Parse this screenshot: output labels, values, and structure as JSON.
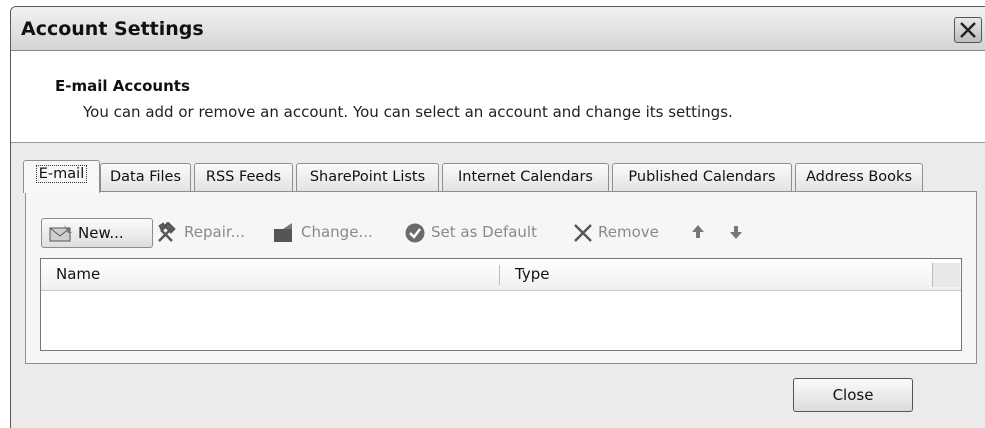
{
  "window": {
    "title": "Account Settings"
  },
  "header": {
    "title": "E-mail Accounts",
    "description": "You can add or remove an account. You can select an account and change its settings."
  },
  "tabs": [
    {
      "label": "E-mail",
      "active": true
    },
    {
      "label": "Data Files",
      "active": false
    },
    {
      "label": "RSS Feeds",
      "active": false
    },
    {
      "label": "SharePoint Lists",
      "active": false
    },
    {
      "label": "Internet Calendars",
      "active": false
    },
    {
      "label": "Published Calendars",
      "active": false
    },
    {
      "label": "Address Books",
      "active": false
    }
  ],
  "toolbar": {
    "new_label": "New...",
    "new_icon": "new-account-icon",
    "repair_label": "Repair...",
    "repair_icon": "tools-icon",
    "change_label": "Change...",
    "change_icon": "change-icon",
    "default_label": "Set as Default",
    "default_icon": "checkmark-circle-icon",
    "remove_label": "Remove",
    "remove_icon": "x-icon",
    "move_up_icon": "arrow-up-icon",
    "move_down_icon": "arrow-down-icon"
  },
  "list": {
    "columns": [
      "Name",
      "Type"
    ],
    "rows": []
  },
  "footer": {
    "close_label": "Close"
  },
  "colors": {
    "dialog_bg": "#ebebeb",
    "panel_bg": "#f6f6f6",
    "disabled_text": "#8a8a8a"
  }
}
